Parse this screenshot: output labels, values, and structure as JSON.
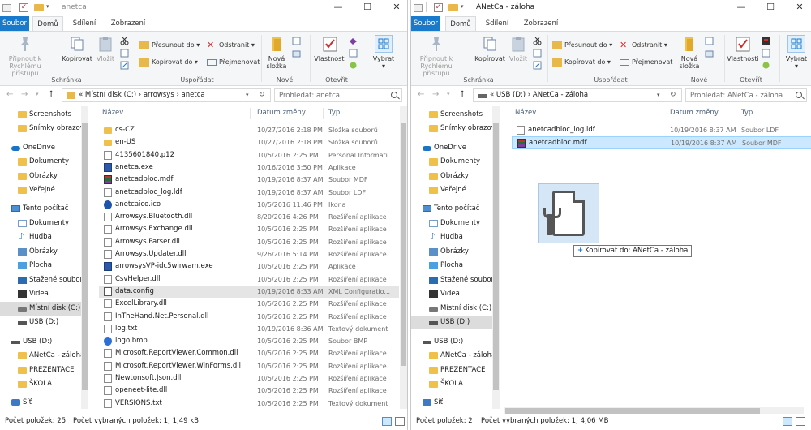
{
  "left": {
    "title": "anetca",
    "tabs": {
      "file": "Soubor",
      "home": "Domů",
      "share": "Sdílení",
      "view": "Zobrazení"
    },
    "ribbon": {
      "pin": "Připnout k Rychlému přístupu",
      "copy": "Kopírovat",
      "paste": "Vložit",
      "clipboard_group": "Schránka",
      "move_to": "Přesunout do",
      "copy_to": "Kopírovat do",
      "delete": "Odstranit",
      "rename": "Přejmenovat",
      "organize_group": "Uspořádat",
      "new_folder": "Nová složka",
      "new_group": "Nové",
      "properties": "Vlastnosti",
      "open_group": "Otevřít",
      "select": "Vybrat"
    },
    "address": {
      "crumbs": "«  Místní disk (C:)  ›  arrowsys  ›  anetca",
      "search_placeholder": "Prohledat: anetca"
    },
    "nav": [
      "Screenshots",
      "Snímky obrazovky",
      "OneDrive",
      "Dokumenty",
      "Obrázky",
      "Veřejné",
      "Tento počítač",
      "Dokumenty",
      "Hudba",
      "Obrázky",
      "Plocha",
      "Stažené soubory",
      "Videa",
      "Místní disk (C:)",
      "USB (D:)",
      "USB (D:)",
      "ANetCa - záloha",
      "PREZENTACE",
      "ŠKOLA",
      "Síť"
    ],
    "columns": {
      "name": "Název",
      "date": "Datum změny",
      "type": "Typ"
    },
    "files": [
      {
        "name": "cs-CZ",
        "date": "10/27/2016 2:18 PM",
        "type": "Složka souborů",
        "icon": "folder"
      },
      {
        "name": "en-US",
        "date": "10/27/2016 2:18 PM",
        "type": "Složka souborů",
        "icon": "folder"
      },
      {
        "name": "4135601840.p12",
        "date": "10/5/2016 2:25 PM",
        "type": "Personal Informati...",
        "icon": "file"
      },
      {
        "name": "anetca.exe",
        "date": "10/16/2016 3:50 PM",
        "type": "Aplikace",
        "icon": "exe"
      },
      {
        "name": "anetcadbloc.mdf",
        "date": "10/19/2016 8:37 AM",
        "type": "Soubor MDF",
        "icon": "rar"
      },
      {
        "name": "anetcadbloc_log.ldf",
        "date": "10/19/2016 8:37 AM",
        "type": "Soubor LDF",
        "icon": "file"
      },
      {
        "name": "anetcaico.ico",
        "date": "10/5/2016 11:46 PM",
        "type": "Ikona",
        "icon": "ico"
      },
      {
        "name": "Arrowsys.Bluetooth.dll",
        "date": "8/20/2016 4:26 PM",
        "type": "Rozšíření aplikace",
        "icon": "file"
      },
      {
        "name": "Arrowsys.Exchange.dll",
        "date": "10/5/2016 2:25 PM",
        "type": "Rozšíření aplikace",
        "icon": "file"
      },
      {
        "name": "Arrowsys.Parser.dll",
        "date": "10/5/2016 2:25 PM",
        "type": "Rozšíření aplikace",
        "icon": "file"
      },
      {
        "name": "Arrowsys.Updater.dll",
        "date": "9/26/2016 5:14 PM",
        "type": "Rozšíření aplikace",
        "icon": "file"
      },
      {
        "name": "arrowsysVP-idc5wjrwam.exe",
        "date": "10/5/2016 2:25 PM",
        "type": "Aplikace",
        "icon": "exe"
      },
      {
        "name": "CsvHelper.dll",
        "date": "10/5/2016 2:25 PM",
        "type": "Rozšíření aplikace",
        "icon": "file"
      },
      {
        "name": "data.config",
        "date": "10/19/2016 8:33 AM",
        "type": "XML Configuratio...",
        "icon": "cfg"
      },
      {
        "name": "ExcelLibrary.dll",
        "date": "10/5/2016 2:25 PM",
        "type": "Rozšíření aplikace",
        "icon": "file"
      },
      {
        "name": "InTheHand.Net.Personal.dll",
        "date": "10/5/2016 2:25 PM",
        "type": "Rozšíření aplikace",
        "icon": "file"
      },
      {
        "name": "log.txt",
        "date": "10/19/2016 8:36 AM",
        "type": "Textový dokument",
        "icon": "file"
      },
      {
        "name": "logo.bmp",
        "date": "10/5/2016 2:25 PM",
        "type": "Soubor BMP",
        "icon": "bmp"
      },
      {
        "name": "Microsoft.ReportViewer.Common.dll",
        "date": "10/5/2016 2:25 PM",
        "type": "Rozšíření aplikace",
        "icon": "file"
      },
      {
        "name": "Microsoft.ReportViewer.WinForms.dll",
        "date": "10/5/2016 2:25 PM",
        "type": "Rozšíření aplikace",
        "icon": "file"
      },
      {
        "name": "Newtonsoft.Json.dll",
        "date": "10/5/2016 2:25 PM",
        "type": "Rozšíření aplikace",
        "icon": "file"
      },
      {
        "name": "openeet-lite.dll",
        "date": "10/5/2016 2:25 PM",
        "type": "Rozšíření aplikace",
        "icon": "file"
      },
      {
        "name": "VERSIONS.txt",
        "date": "10/5/2016 2:25 PM",
        "type": "Textový dokument",
        "icon": "file"
      }
    ],
    "status": {
      "count": "Počet položek: 25",
      "selected": "Počet vybraných položek: 1; 1,49 kB"
    }
  },
  "right": {
    "title": "ANetCa - záloha",
    "tabs": {
      "file": "Soubor",
      "home": "Domů",
      "share": "Sdílení",
      "view": "Zobrazení"
    },
    "ribbon": {
      "pin": "Připnout k Rychlému přístupu",
      "copy": "Kopírovat",
      "paste": "Vložit",
      "clipboard_group": "Schránka",
      "move_to": "Přesunout do",
      "copy_to": "Kopírovat do",
      "delete": "Odstranit",
      "rename": "Přejmenovat",
      "organize_group": "Uspořádat",
      "new_folder": "Nová složka",
      "new_group": "Nové",
      "properties": "Vlastnosti",
      "open_group": "Otevřít",
      "select": "Vybrat"
    },
    "address": {
      "crumbs": "«  USB (D:)  ›  ANetCa - záloha",
      "search_placeholder": "Prohledat: ANetCa - záloha"
    },
    "nav": [
      "Screenshots",
      "Snímky obrazovky",
      "OneDrive",
      "Dokumenty",
      "Obrázky",
      "Veřejné",
      "Tento počítač",
      "Dokumenty",
      "Hudba",
      "Obrázky",
      "Plocha",
      "Stažené soubory",
      "Videa",
      "Místní disk (C:)",
      "USB (D:)",
      "USB (D:)",
      "ANetCa - záloha",
      "PREZENTACE",
      "ŠKOLA",
      "Síť"
    ],
    "columns": {
      "name": "Název",
      "date": "Datum změny",
      "type": "Typ"
    },
    "files": [
      {
        "name": "anetcadbloc_log.ldf",
        "date": "10/19/2016 8:37 AM",
        "type": "Soubor LDF",
        "icon": "file"
      },
      {
        "name": "anetcadbloc.mdf",
        "date": "10/19/2016 8:37 AM",
        "type": "Soubor MDF",
        "icon": "rar"
      }
    ],
    "status": {
      "count": "Počet položek: 2",
      "selected": "Počet vybraných položek: 1; 4,06 MB"
    }
  },
  "drag": {
    "tooltip": "Kopírovat do: ANetCa - záloha",
    "plus": "+"
  }
}
